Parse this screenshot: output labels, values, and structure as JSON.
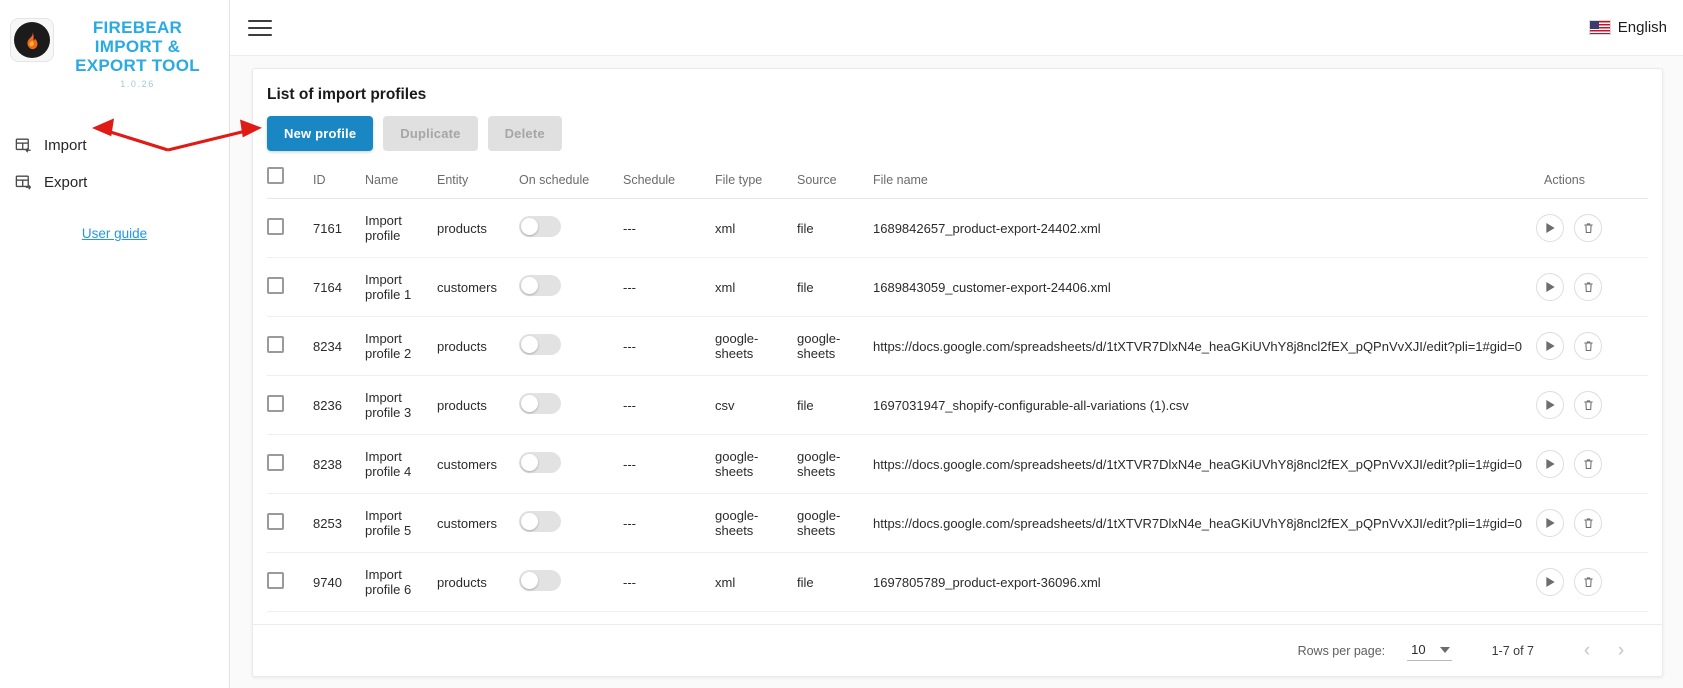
{
  "sidebar": {
    "brand": {
      "title_line1": "FIREBEAR",
      "title_line2": "IMPORT &",
      "title_line3": "EXPORT TOOL",
      "version": "1.0.26",
      "logo_icon": "firebear-flame-logo"
    },
    "items": [
      {
        "label": "Import",
        "icon": "import-table-icon"
      },
      {
        "label": "Export",
        "icon": "export-table-icon"
      }
    ],
    "user_guide_label": "User guide"
  },
  "topbar": {
    "menu_icon": "hamburger-menu-icon",
    "language": "English",
    "flag_icon": "us-flag-icon"
  },
  "main": {
    "card_title": "List of import profiles",
    "buttons": {
      "new_profile": "New profile",
      "duplicate": "Duplicate",
      "delete": "Delete"
    },
    "table": {
      "columns": [
        "",
        "ID",
        "Name",
        "Entity",
        "On schedule",
        "Schedule",
        "File type",
        "Source",
        "File name",
        "Actions"
      ],
      "rows": [
        {
          "id": "7161",
          "name": "Import profile",
          "entity": "products",
          "on_schedule": false,
          "schedule": "---",
          "file_type": "xml",
          "source": "file",
          "file_name": "1689842657_product-export-24402.xml"
        },
        {
          "id": "7164",
          "name": "Import profile 1",
          "entity": "customers",
          "on_schedule": false,
          "schedule": "---",
          "file_type": "xml",
          "source": "file",
          "file_name": "1689843059_customer-export-24406.xml"
        },
        {
          "id": "8234",
          "name": "Import profile 2",
          "entity": "products",
          "on_schedule": false,
          "schedule": "---",
          "file_type": "google-sheets",
          "source": "google-sheets",
          "file_name": "https://docs.google.com/spreadsheets/d/1tXTVR7DlxN4e_heaGKiUVhY8j8ncl2fEX_pQPnVvXJI/edit?pli=1#gid=0"
        },
        {
          "id": "8236",
          "name": "Import profile 3",
          "entity": "products",
          "on_schedule": false,
          "schedule": "---",
          "file_type": "csv",
          "source": "file",
          "file_name": "1697031947_shopify-configurable-all-variations (1).csv"
        },
        {
          "id": "8238",
          "name": "Import profile 4",
          "entity": "customers",
          "on_schedule": false,
          "schedule": "---",
          "file_type": "google-sheets",
          "source": "google-sheets",
          "file_name": "https://docs.google.com/spreadsheets/d/1tXTVR7DlxN4e_heaGKiUVhY8j8ncl2fEX_pQPnVvXJI/edit?pli=1#gid=0"
        },
        {
          "id": "8253",
          "name": "Import profile 5",
          "entity": "customers",
          "on_schedule": false,
          "schedule": "---",
          "file_type": "google-sheets",
          "source": "google-sheets",
          "file_name": "https://docs.google.com/spreadsheets/d/1tXTVR7DlxN4e_heaGKiUVhY8j8ncl2fEX_pQPnVvXJI/edit?pli=1#gid=0"
        },
        {
          "id": "9740",
          "name": "Import profile 6",
          "entity": "products",
          "on_schedule": false,
          "schedule": "---",
          "file_type": "xml",
          "source": "file",
          "file_name": "1697805789_product-export-36096.xml"
        }
      ],
      "row_actions": {
        "run_icon": "play-icon",
        "delete_icon": "trash-icon"
      }
    },
    "pagination": {
      "rows_per_page_label": "Rows per page:",
      "rows_per_page_value": "10",
      "range_label": "1-7 of 7",
      "prev_icon": "chevron-left-icon",
      "next_icon": "chevron-right-icon"
    }
  },
  "colors": {
    "brand": "#29abe2",
    "primary_button": "#1887c4",
    "annotation": "#e01b16"
  }
}
